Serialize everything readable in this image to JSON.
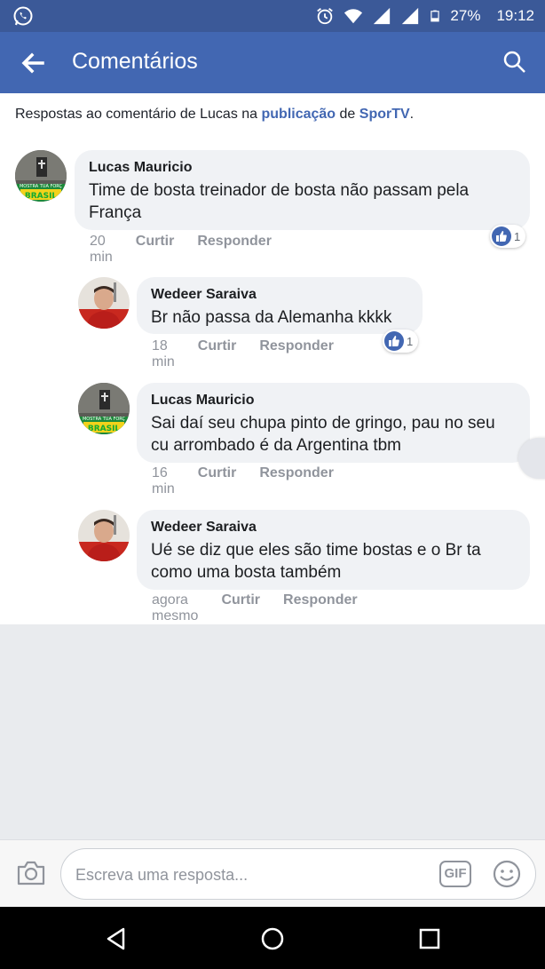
{
  "status_bar": {
    "battery": "27%",
    "time": "19:12"
  },
  "app_bar": {
    "title": "Comentários"
  },
  "context": {
    "prefix": "Respostas ao comentário de Lucas na ",
    "publication_link": "publicação",
    "middle": " de ",
    "page_link": "SporTV",
    "suffix": "."
  },
  "comments": [
    {
      "author": "Lucas Mauricio",
      "text": "Time de bosta treinador de bosta não passam pela França",
      "time": "20 min",
      "like_label": "Curtir",
      "reply_label": "Responder",
      "reactions": "1"
    },
    {
      "author": "Wedeer Saraiva",
      "text": "Br não passa da Alemanha kkkk",
      "time": "18 min",
      "like_label": "Curtir",
      "reply_label": "Responder",
      "reactions": "1"
    },
    {
      "author": "Lucas Mauricio",
      "text": "Sai daí seu chupa pinto de gringo, pau no seu cu arrombado é da Argentina tbm",
      "time": "16 min",
      "like_label": "Curtir",
      "reply_label": "Responder"
    },
    {
      "author": "Wedeer Saraiva",
      "text": "Ué se diz que eles são time bostas e o Br ta como uma bosta também",
      "time": "agora mesmo",
      "like_label": "Curtir",
      "reply_label": "Responder"
    }
  ],
  "avatar_text": {
    "top": "MOSTRA TUA FORÇ",
    "bottom": "BRASIL"
  },
  "composer": {
    "placeholder": "Escreva uma resposta...",
    "gif_label": "GIF"
  },
  "colors": {
    "brand": "#4267b2",
    "status_bar": "#3b5998",
    "link": "#4267b2"
  },
  "icons": [
    "whatsapp-icon",
    "alarm-icon",
    "wifi-icon",
    "signal-icon",
    "battery-icon",
    "back-arrow-icon",
    "search-icon",
    "like-icon",
    "camera-icon",
    "gif-icon",
    "emoji-icon",
    "nav-back-icon",
    "nav-home-icon",
    "nav-recents-icon"
  ]
}
